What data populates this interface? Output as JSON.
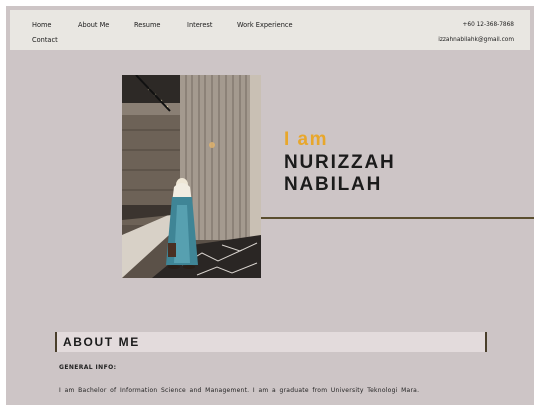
{
  "nav": {
    "items": [
      "Home",
      "About Me",
      "Resume",
      "Interest",
      "Work Experience",
      "Contact"
    ]
  },
  "contact": {
    "phone": "+60 12-368-7868",
    "email": "izzahnabilahk@gmail.com"
  },
  "hero": {
    "greeting": "I am",
    "first_name": "NURIZZAH",
    "last_name": "NABILAH",
    "accent_color": "#e8a72b"
  },
  "about": {
    "heading": "ABOUT ME",
    "subheading": "GENERAL  INFO:",
    "bio": "I am Bachelor of Information Science and Management. I am a graduate from University Teknologi Mara."
  }
}
